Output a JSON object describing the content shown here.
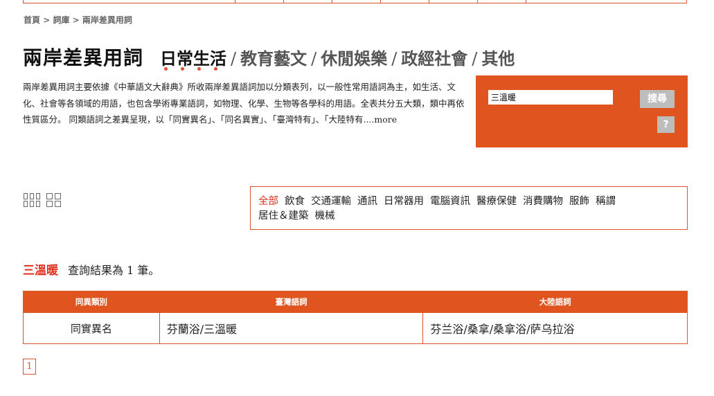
{
  "breadcrumb": {
    "home": "首頁",
    "sep1": " > ",
    "lexicon": "詞庫",
    "sep2": " > ",
    "current": "兩岸差異用詞"
  },
  "header": {
    "title": "兩岸差異用詞",
    "categories": [
      "日常生活",
      "教育藝文",
      "休閒娛樂",
      "政經社會",
      "其他"
    ],
    "separator": "/",
    "active_index": 0
  },
  "description": {
    "text": "兩岸差異用詞主要依據《中華語文大辭典》所收兩岸差異語詞加以分類表列，以一般性常用語詞為主，如生活、文化、社會等各領域的用語，也包含學術專業語詞，如物理、化學、生物等各學科的用語。全表共分五大類，類中再依性質區分。 同類語詞之差異呈現，以「同實異名」、「同名異實」、「臺灣特有」、「大陸特有",
    "more": "....more"
  },
  "search": {
    "value": "三溫暖",
    "button_label": "搜尋",
    "help_label": "?"
  },
  "subcategories": [
    "全部",
    "飲食",
    "交通運輸",
    "通訊",
    "日常器用",
    "電腦資訊",
    "醫療保健",
    "消費購物",
    "服飾",
    "稱謂",
    "居住＆建築",
    "機械"
  ],
  "result": {
    "keyword": "三溫暖",
    "summary": "查詢結果為 1 筆。"
  },
  "table": {
    "headers": [
      "同異類別",
      "臺灣語詞",
      "大陸語詞"
    ],
    "rows": [
      [
        "同實異名",
        "芬蘭浴/三溫暖",
        "芬兰浴/桑拿/桑拿浴/萨乌拉浴"
      ]
    ]
  },
  "pagination": {
    "current": "1"
  },
  "colors": {
    "accent": "#e05420",
    "highlight": "#e0301e",
    "button_gray": "#bdbdbd"
  },
  "icons": {
    "view_a": "grid-3col-icon",
    "view_b": "grid-2col-icon"
  }
}
